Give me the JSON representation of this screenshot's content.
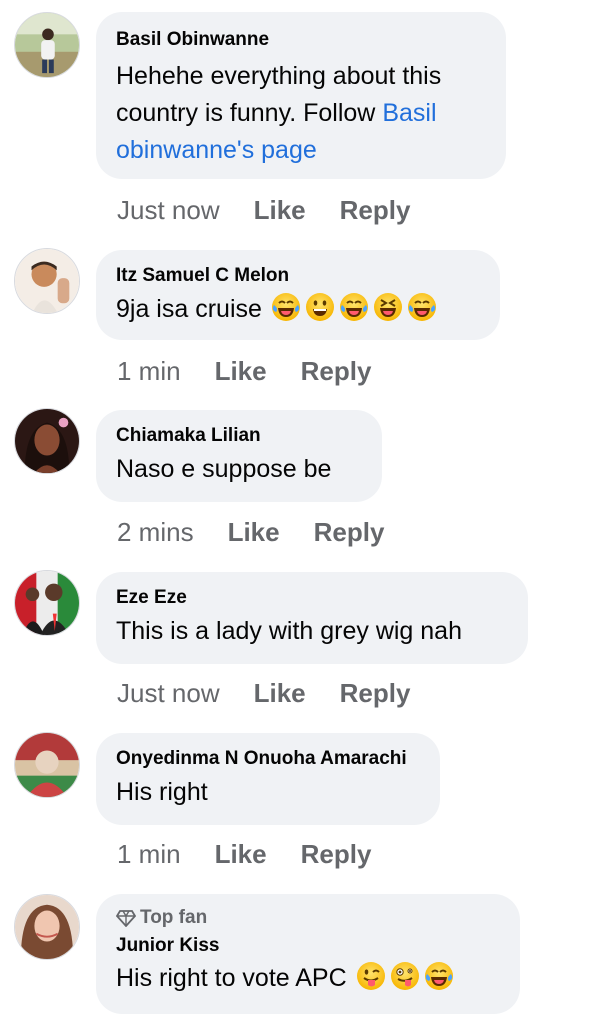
{
  "comments": [
    {
      "author": "Basil Obinwanne",
      "text_line1": "Hehehe everything about this",
      "text_line2_plain": "country is funny. Follow ",
      "text_line2_link": "Basil",
      "text_line3_link": "obinwanne's page",
      "time": "Just now",
      "like": "Like",
      "reply": "Reply"
    },
    {
      "author": "Itz Samuel C Melon",
      "text": "9ja isa cruise",
      "emojis": [
        "tears-of-joy-icon",
        "grinning-icon",
        "tears-of-joy-icon",
        "squinting-laugh-icon",
        "tears-of-joy-icon"
      ],
      "time": "1 min",
      "like": "Like",
      "reply": "Reply"
    },
    {
      "author": "Chiamaka Lilian",
      "text": "Naso e suppose be",
      "time": "2 mins",
      "like": "Like",
      "reply": "Reply"
    },
    {
      "author": "Eze Eze",
      "text": "This is a lady with grey wig nah",
      "time": "Just now",
      "like": "Like",
      "reply": "Reply"
    },
    {
      "author": "Onyedinma N Onuoha Amarachi",
      "text": "His right",
      "time": "1 min",
      "like": "Like",
      "reply": "Reply"
    },
    {
      "author": "Junior Kiss",
      "badge": "Top fan",
      "text": "His right to vote APC",
      "emojis": [
        "winking-tongue-icon",
        "zany-face-icon",
        "tears-of-joy-icon"
      ]
    }
  ],
  "colors": {
    "bubble": "#f0f2f5",
    "link": "#216fdb",
    "meta": "#65676b",
    "text": "#050505"
  }
}
